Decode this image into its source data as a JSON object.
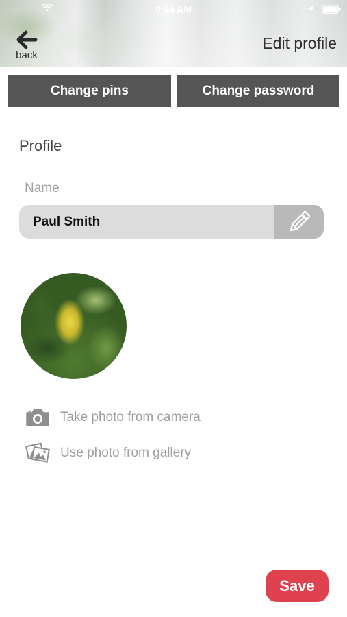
{
  "status_bar": {
    "time": "9:44 AM"
  },
  "header": {
    "back_label": "back",
    "title": "Edit profile"
  },
  "top_buttons": {
    "change_pins": "Change pins",
    "change_password": "Change password"
  },
  "profile": {
    "section_title": "Profile",
    "name_label": "Name",
    "name_value": "Paul Smith"
  },
  "photo_options": {
    "camera": "Take photo from camera",
    "gallery": "Use photo from gallery"
  },
  "actions": {
    "save": "Save"
  },
  "colors": {
    "dark_button": "#555555",
    "save_button": "#e0414e",
    "field_bg": "#dcdcdc"
  },
  "icons": [
    "wifi-icon",
    "location-icon",
    "battery-icon",
    "back-arrow-icon",
    "pencil-icon",
    "camera-icon",
    "gallery-icon"
  ]
}
